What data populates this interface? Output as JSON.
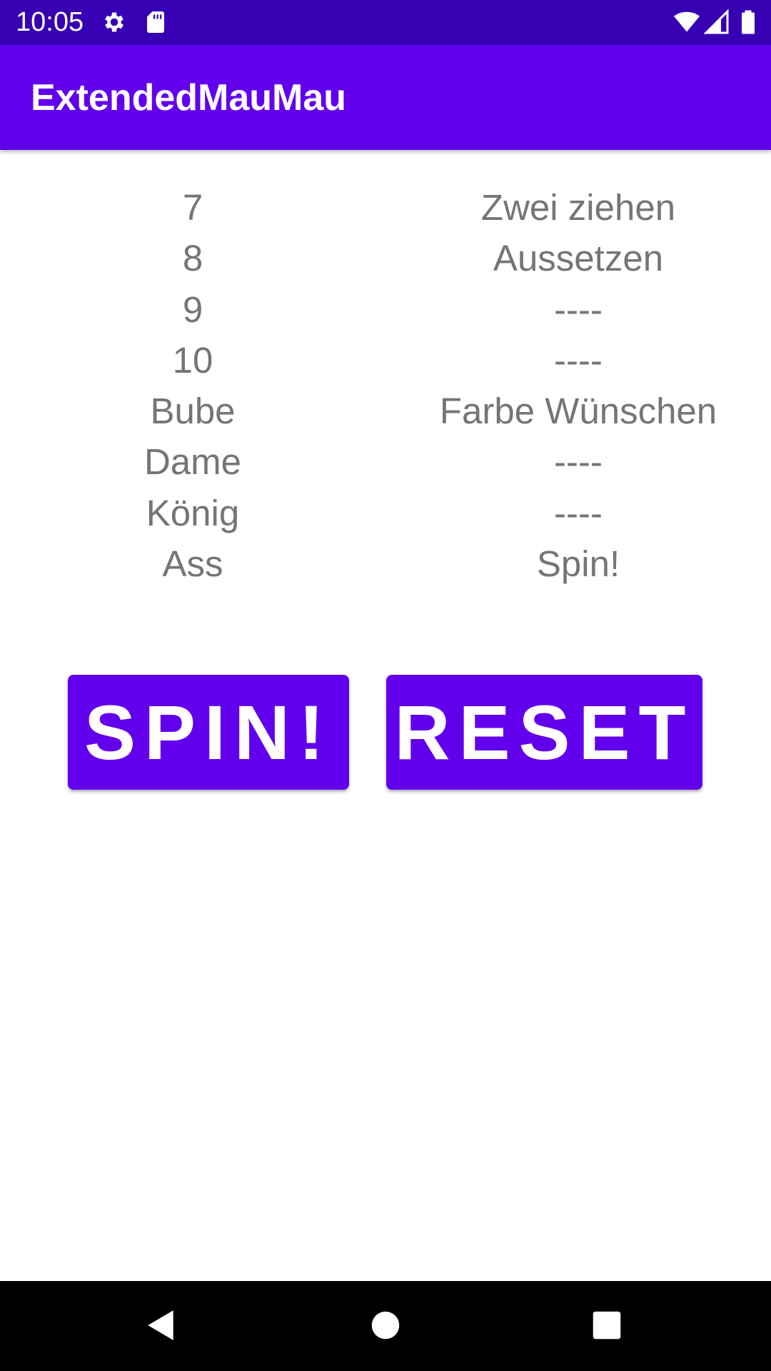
{
  "status_bar": {
    "time": "10:05",
    "icons": [
      "gear-icon",
      "sd-card-icon",
      "wifi-icon",
      "signal-icon",
      "battery-icon"
    ]
  },
  "app_bar": {
    "title": "ExtendedMauMau"
  },
  "rules": [
    {
      "card": "7",
      "effect": "Zwei ziehen"
    },
    {
      "card": "8",
      "effect": "Aussetzen"
    },
    {
      "card": "9",
      "effect": "----"
    },
    {
      "card": "10",
      "effect": "----"
    },
    {
      "card": "Bube",
      "effect": "Farbe Wünschen"
    },
    {
      "card": "Dame",
      "effect": "----"
    },
    {
      "card": "König",
      "effect": "----"
    },
    {
      "card": "Ass",
      "effect": "Spin!"
    }
  ],
  "buttons": {
    "spin_label": "SPIN!",
    "reset_label": "RESET"
  },
  "nav_bar": {
    "icons": [
      "back-icon",
      "home-icon",
      "recents-icon"
    ]
  },
  "colors": {
    "status_bar": "#3700b3",
    "primary": "#6200ee",
    "rule_text": "#757575"
  }
}
